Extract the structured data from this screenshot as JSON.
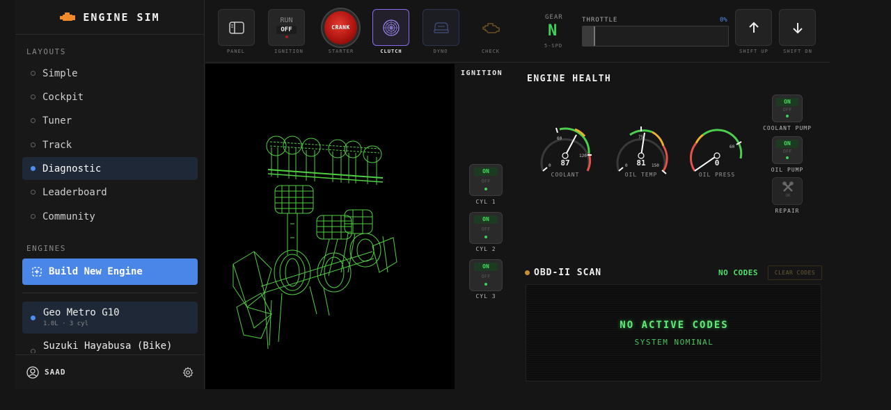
{
  "app": {
    "title": "ENGINE SIM"
  },
  "sidebar": {
    "layouts_heading": "LAYOUTS",
    "layouts": [
      {
        "label": "Simple",
        "active": false
      },
      {
        "label": "Cockpit",
        "active": false
      },
      {
        "label": "Tuner",
        "active": false
      },
      {
        "label": "Track",
        "active": false
      },
      {
        "label": "Diagnostic",
        "active": true
      },
      {
        "label": "Leaderboard",
        "active": false
      },
      {
        "label": "Community",
        "active": false
      }
    ],
    "engines_heading": "ENGINES",
    "build_label": "Build New Engine",
    "engines": [
      {
        "name": "Geo Metro G10",
        "sub": "1.0L · 3 cyl",
        "active": true
      },
      {
        "name": "Suzuki Hayabusa (Bike)",
        "sub": "",
        "active": false
      }
    ],
    "user": "SAAD"
  },
  "toolbar": {
    "panel_label": "PANEL",
    "ignition_run": "RUN",
    "ignition_off": "OFF",
    "ignition_label": "IGNITION",
    "crank_text": "CRANK",
    "starter_label": "STARTER",
    "clutch_label": "CLUTCH",
    "dyno_label": "DYNO",
    "check_label": "CHECK",
    "gear_label": "GEAR",
    "gear_value": "N",
    "gear_sub": "5-SPD",
    "throttle_label": "THROTTLE",
    "throttle_pct": "0%",
    "throttle_value": 0,
    "shift_up_label": "SHIFT UP",
    "shift_dn_label": "SHIFT DN"
  },
  "ignition": {
    "title": "IGNITION",
    "cylinders": [
      {
        "label": "CYL 1",
        "on": "ON",
        "off": "OFF"
      },
      {
        "label": "CYL 2",
        "on": "ON",
        "off": "OFF"
      },
      {
        "label": "CYL 3",
        "on": "ON",
        "off": "OFF"
      }
    ]
  },
  "health": {
    "title": "ENGINE HEALTH",
    "gauges": [
      {
        "label": "COOLANT",
        "value": "87",
        "min": "0",
        "mid": "60",
        "max": "120"
      },
      {
        "label": "OIL TEMP",
        "value": "81",
        "min": "0",
        "mid": "75",
        "max": "150"
      },
      {
        "label": "OIL PRESS",
        "value": "0",
        "mid": "60"
      }
    ],
    "pumps": [
      {
        "label": "COOLANT PUMP",
        "on": "ON",
        "off": "OFF"
      },
      {
        "label": "OIL PUMP",
        "on": "ON",
        "off": "OFF"
      }
    ],
    "repair_label": "REPAIR",
    "repair_ok": "OK"
  },
  "obd": {
    "title": "OBD-II SCAN",
    "status": "NO CODES",
    "clear_label": "CLEAR CODES",
    "main": "NO ACTIVE CODES",
    "sub": "SYSTEM NOMINAL"
  },
  "colors": {
    "accent": "#4a86e8",
    "green": "#3dd35a",
    "wire": "#59e84a",
    "crank": "#c8201d",
    "clutch": "#8a6cf0"
  }
}
